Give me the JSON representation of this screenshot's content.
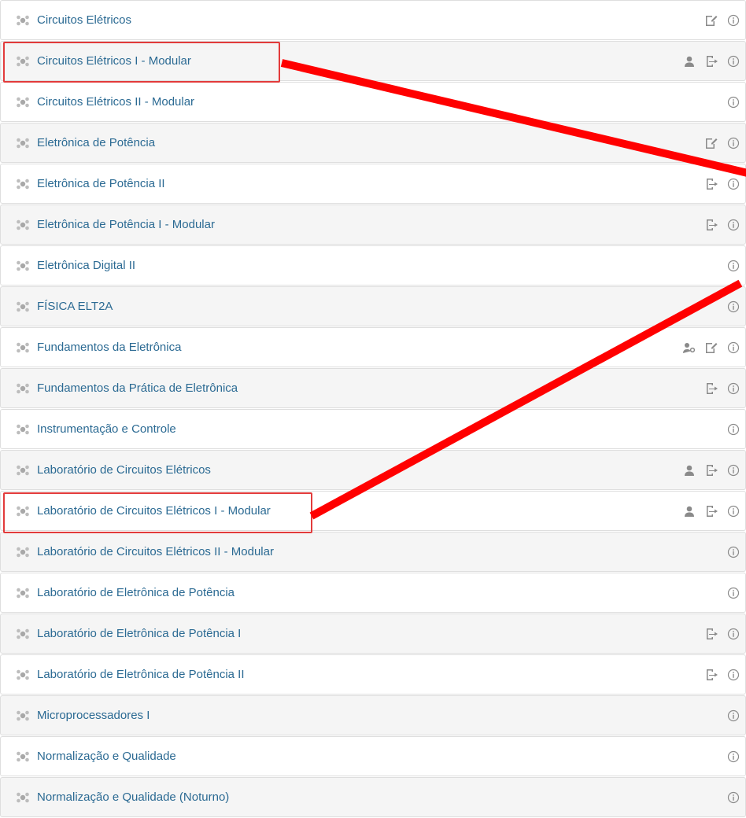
{
  "courses": [
    {
      "title": "Circuitos Elétricos",
      "icons": [
        "edit-key-icon",
        "info-icon"
      ]
    },
    {
      "title": "Circuitos Elétricos I - Modular",
      "icons": [
        "user-icon",
        "enter-icon",
        "info-icon"
      ]
    },
    {
      "title": "Circuitos Elétricos II - Modular",
      "icons": [
        "info-icon"
      ]
    },
    {
      "title": "Eletrônica de Potência",
      "icons": [
        "edit-key-icon",
        "info-icon"
      ]
    },
    {
      "title": "Eletrônica de Potência II",
      "icons": [
        "enter-icon",
        "info-icon"
      ]
    },
    {
      "title": "Eletrônica de Potência I - Modular",
      "icons": [
        "enter-icon",
        "info-icon"
      ]
    },
    {
      "title": "Eletrônica Digital II",
      "icons": [
        "info-icon"
      ]
    },
    {
      "title": "FÍSICA ELT2A",
      "icons": [
        "info-icon"
      ]
    },
    {
      "title": "Fundamentos da Eletrônica",
      "icons": [
        "guest-key-icon",
        "edit-key-icon",
        "info-icon"
      ]
    },
    {
      "title": "Fundamentos da Prática de Eletrônica",
      "icons": [
        "enter-icon",
        "info-icon"
      ]
    },
    {
      "title": "Instrumentação e Controle",
      "icons": [
        "info-icon"
      ]
    },
    {
      "title": "Laboratório de Circuitos Elétricos",
      "icons": [
        "user-icon",
        "enter-icon",
        "info-icon"
      ]
    },
    {
      "title": "Laboratório de Circuitos Elétricos I - Modular",
      "icons": [
        "user-icon",
        "enter-icon",
        "info-icon"
      ]
    },
    {
      "title": "Laboratório de Circuitos Elétricos II - Modular",
      "icons": [
        "info-icon"
      ]
    },
    {
      "title": "Laboratório de Eletrônica de Potência",
      "icons": [
        "info-icon"
      ]
    },
    {
      "title": "Laboratório de Eletrônica de Potência I",
      "icons": [
        "enter-icon",
        "info-icon"
      ]
    },
    {
      "title": "Laboratório de Eletrônica de Potência II",
      "icons": [
        "enter-icon",
        "info-icon"
      ]
    },
    {
      "title": "Microprocessadores I",
      "icons": [
        "info-icon"
      ]
    },
    {
      "title": "Normalização e Qualidade",
      "icons": [
        "info-icon"
      ]
    },
    {
      "title": "Normalização e Qualidade (Noturno)",
      "icons": [
        "info-icon"
      ]
    }
  ],
  "highlighted_courses": [
    "Circuitos Elétricos I - Modular",
    "Laboratório de Circuitos Elétricos I - Modular"
  ],
  "colors": {
    "link": "#2b6a93",
    "icon_gray": "#8a8a8a",
    "highlight_box": "#e23b3b",
    "annotation_line": "#ff0000",
    "row_alt_bg": "#f5f5f5",
    "row_border": "#dedede"
  }
}
